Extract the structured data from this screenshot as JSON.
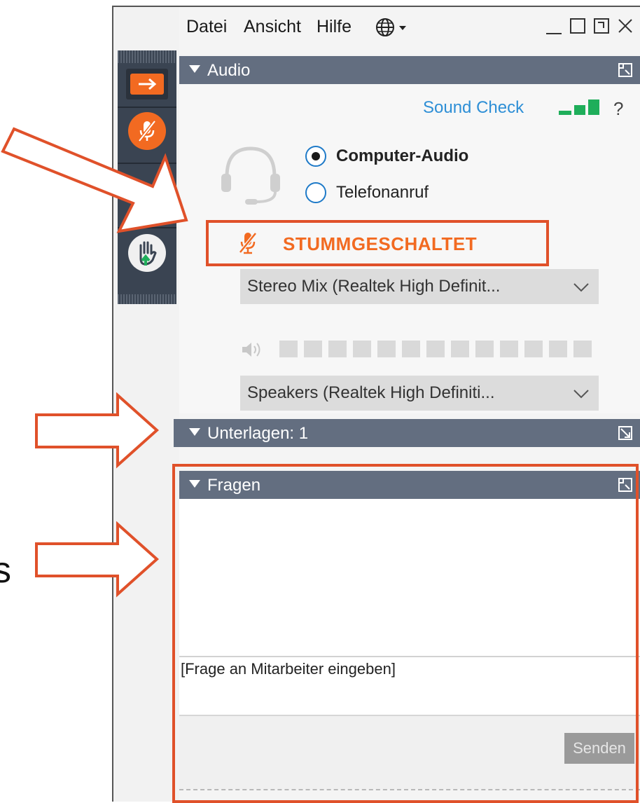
{
  "menu": {
    "file": "Datei",
    "view": "Ansicht",
    "help": "Hilfe",
    "language_icon": "globe-icon"
  },
  "window_controls": [
    "minimize-icon",
    "maximize-icon",
    "restore-icon",
    "close-icon"
  ],
  "audio_panel": {
    "title": "Audio",
    "sound_check": "Sound Check",
    "help": "?",
    "options": [
      {
        "label": "Computer-Audio",
        "selected": true
      },
      {
        "label": "Telefonanruf",
        "selected": false
      }
    ],
    "mute_status": "STUMMGESCHALTET",
    "microphone_device": "Stereo  Mix (Realtek  High  Definit...",
    "speaker_device": "Speakers  (Realtek  High  Definiti...",
    "level_segments": 13
  },
  "handouts_panel": {
    "title": "Unterlagen: 1"
  },
  "questions_panel": {
    "title": "Fragen",
    "input_placeholder": "[Frage an Mitarbeiter eingeben]",
    "send_label": "Senden"
  },
  "left_edge_text": "s",
  "colors": {
    "accent_orange": "#f26a21",
    "highlight_red": "#e0512a",
    "header_slate": "#636e80",
    "toolbar_dark": "#3a4452",
    "link_blue": "#2e8fd6",
    "signal_green": "#1fae5a"
  }
}
